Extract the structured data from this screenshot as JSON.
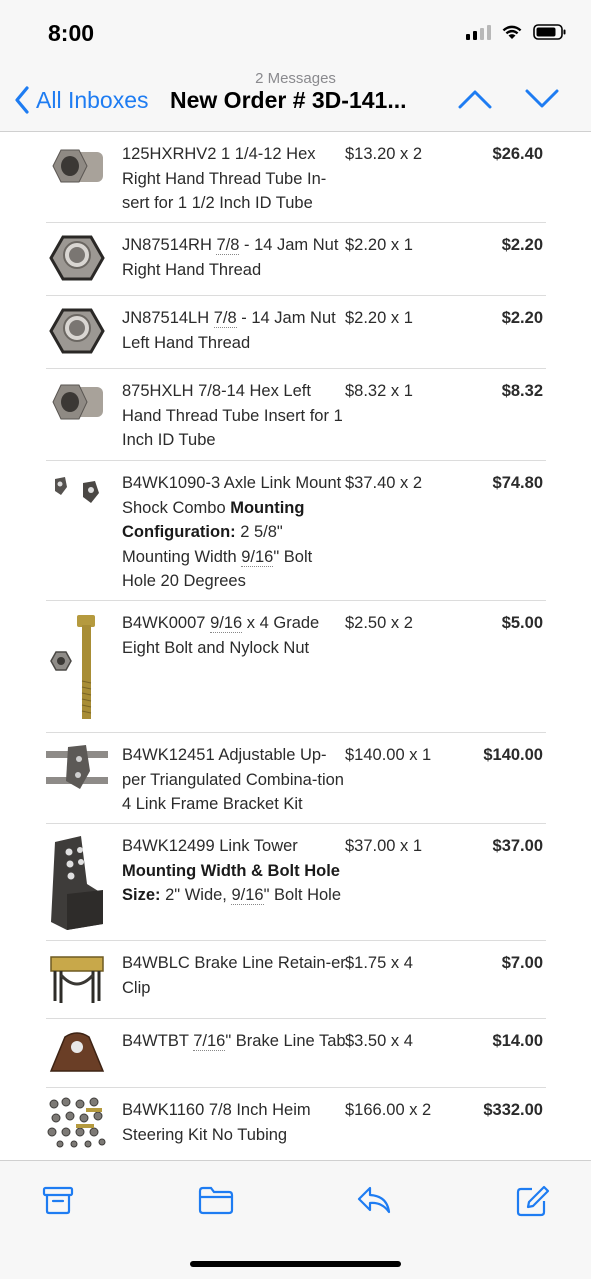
{
  "status": {
    "time": "8:00"
  },
  "nav": {
    "message_count": "2 Messages",
    "back_label": "All Inboxes",
    "title": "New Order # 3D-141..."
  },
  "colors": {
    "accent": "#1e7cf2",
    "bar_bg": "#f7f7f7"
  },
  "toolbar": {
    "icons": [
      "archive-icon",
      "folder-icon",
      "reply-icon",
      "compose-icon"
    ]
  },
  "items": [
    {
      "desc_text": "125HXRHV2 1 1/4-12 Hex Right Hand Thread Tube In-sert for 1 1/2 Inch ID Tube",
      "qty": "$13.20 x 2",
      "total": "$26.40",
      "icon": "hex-tube-insert"
    },
    {
      "desc_pre": "JN87514RH ",
      "desc_ul": "7/8",
      "desc_post": " - 14 Jam Nut Right Hand Thread",
      "qty": "$2.20 x 1",
      "total": "$2.20",
      "icon": "jam-nut"
    },
    {
      "desc_pre": "JN87514LH ",
      "desc_ul": "7/8",
      "desc_post": " - 14 Jam Nut Left Hand Thread",
      "qty": "$2.20 x 1",
      "total": "$2.20",
      "icon": "jam-nut"
    },
    {
      "desc_text": "875HXLH 7/8-14 Hex Left Hand Thread Tube Insert for 1 Inch ID Tube",
      "qty": "$8.32 x 1",
      "total": "$8.32",
      "icon": "hex-tube-insert"
    },
    {
      "desc_text": "B4WK1090-3 Axle Link Mount Shock Combo",
      "bold_label": "Mounting Configuration:",
      "detail_pre": " 2 5/8\" Mounting Width ",
      "detail_ul": "9/16",
      "detail_post": "\" Bolt Hole 20 Degrees",
      "qty": "$37.40 x 2",
      "total": "$74.80",
      "icon": "axle-mount-brackets"
    },
    {
      "desc_pre": "B4WK0007 ",
      "desc_ul": "9/16",
      "desc_post": " x 4 Grade Eight Bolt and Nylock Nut",
      "qty": "$2.50 x 2",
      "total": "$5.00",
      "icon": "bolt-and-nut"
    },
    {
      "desc_text": "B4WK12451 Adjustable Up-per Triangulated Combina-tion 4 Link Frame Bracket Kit",
      "qty": "$140.00 x 1",
      "total": "$140.00",
      "icon": "frame-bracket-kit"
    },
    {
      "desc_text": "B4WK12499 Link Tower",
      "bold_label": "Mounting Width & Bolt Hole Size:",
      "detail_pre": " 2\" Wide, ",
      "detail_ul": "9/16",
      "detail_post": "\" Bolt Hole",
      "qty": "$37.00 x 1",
      "total": "$37.00",
      "icon": "link-tower"
    },
    {
      "desc_text": "B4WBLC Brake Line Retain-er Clip",
      "qty": "$1.75 x 4",
      "total": "$7.00",
      "icon": "retainer-clip"
    },
    {
      "desc_pre": "B4WTBT ",
      "desc_ul": "7/16",
      "desc_post": "\" Brake Line Tab",
      "qty": "$3.50 x 4",
      "total": "$14.00",
      "icon": "brake-line-tab"
    },
    {
      "desc_text": "B4WK1160 7/8 Inch Heim Steering Kit No Tubing",
      "qty": "$166.00 x 2",
      "total": "$332.00",
      "icon": "heim-steering-kit"
    }
  ]
}
